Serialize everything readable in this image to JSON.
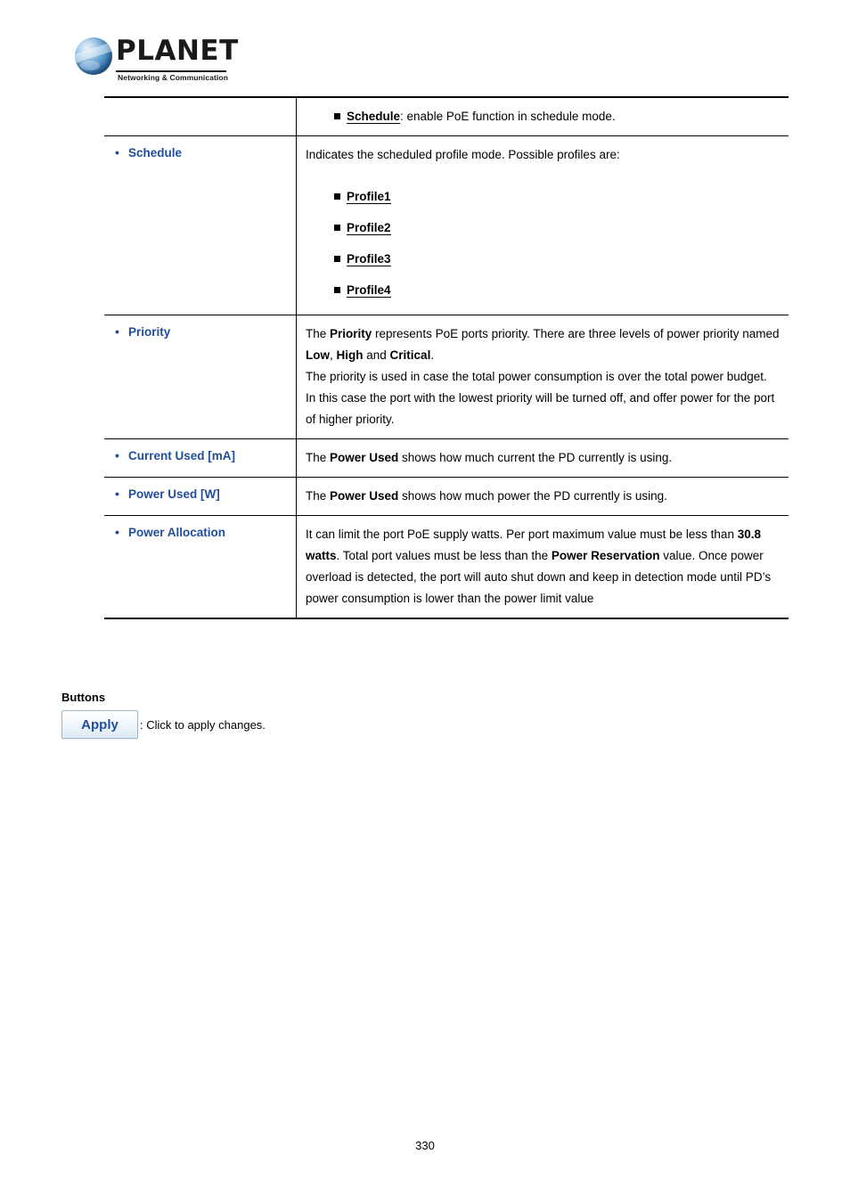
{
  "brand": {
    "name": "PLANET",
    "tagline": "Networking & Communication",
    "logo_icon": "globe-icon",
    "accent_color": "#1f4e9c"
  },
  "table": {
    "rows": [
      {
        "term": "",
        "intro": "",
        "bullets": [
          {
            "keyword": "Schedule",
            "underline": true,
            "rest": ": enable PoE function in schedule mode."
          }
        ],
        "paragraphs": []
      },
      {
        "term": "Schedule",
        "intro": "Indicates the scheduled profile mode. Possible profiles are:",
        "bullets": [
          {
            "keyword": "Profile1",
            "underline": true,
            "rest": ""
          },
          {
            "keyword": "Profile2",
            "underline": true,
            "rest": ""
          },
          {
            "keyword": "Profile3",
            "underline": true,
            "rest": ""
          },
          {
            "keyword": "Profile4",
            "underline": true,
            "rest": ""
          }
        ],
        "paragraphs": []
      },
      {
        "term": "Priority",
        "intro": "",
        "bullets": [],
        "paragraphs": [
          "The Priority represents PoE ports priority. There are three levels of power priority named Low, High and Critical.",
          "The priority is used in case the total power consumption is over the total power budget. In this case the port with the lowest priority will be turned off, and offer power for the port of higher priority."
        ]
      },
      {
        "term": "Current Used [mA]",
        "intro": "",
        "bullets": [],
        "paragraphs": [
          "The Power Used shows how much current the PD currently is using."
        ]
      },
      {
        "term": "Power Used [W]",
        "intro": "",
        "bullets": [],
        "paragraphs": [
          "The Power Used shows how much power the PD currently is using."
        ]
      },
      {
        "term": "Power Allocation",
        "intro": "",
        "bullets": [],
        "paragraphs": [
          "It can limit the port PoE supply watts. Per port maximum value must be less than 30.8 watts. Total port values must be less than the Power Reservation value. Once power overload is detected, the port will auto shut down and keep in detection mode until PD’s power consumption is lower than the power limit value"
        ]
      }
    ]
  },
  "buttons_section": {
    "heading": "Buttons",
    "apply_label": "Apply",
    "apply_caption": ": Click to apply changes."
  },
  "footer": {
    "page_number": "330"
  }
}
